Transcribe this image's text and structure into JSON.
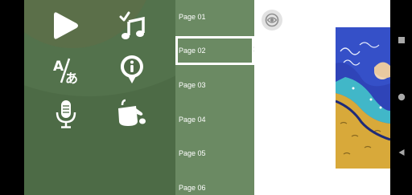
{
  "menu": {
    "items": [
      {
        "name": "play-icon"
      },
      {
        "name": "music-icon"
      },
      {
        "name": "translate-icon"
      },
      {
        "name": "info-icon"
      },
      {
        "name": "microphone-icon"
      },
      {
        "name": "paint-bucket-icon"
      }
    ]
  },
  "pages": {
    "items": [
      {
        "label": "Page 01"
      },
      {
        "label": "Page 02"
      },
      {
        "label": "Page 03"
      },
      {
        "label": "Page 04"
      },
      {
        "label": "Page 05"
      },
      {
        "label": "Page 06"
      }
    ],
    "selected_index": 1,
    "selected_marker": ">"
  },
  "viewer": {
    "toggle_icon": "eye-icon"
  },
  "system_nav": {
    "items": [
      {
        "name": "recents-icon"
      },
      {
        "name": "home-icon"
      },
      {
        "name": "back-icon"
      }
    ]
  },
  "colors": {
    "menu_bg": "#4d6b46",
    "page_list_bg": "#6b8a63",
    "selection_border": "#ffffff",
    "illustration_blue": "#2f44b8",
    "illustration_gold": "#d8a93a"
  }
}
